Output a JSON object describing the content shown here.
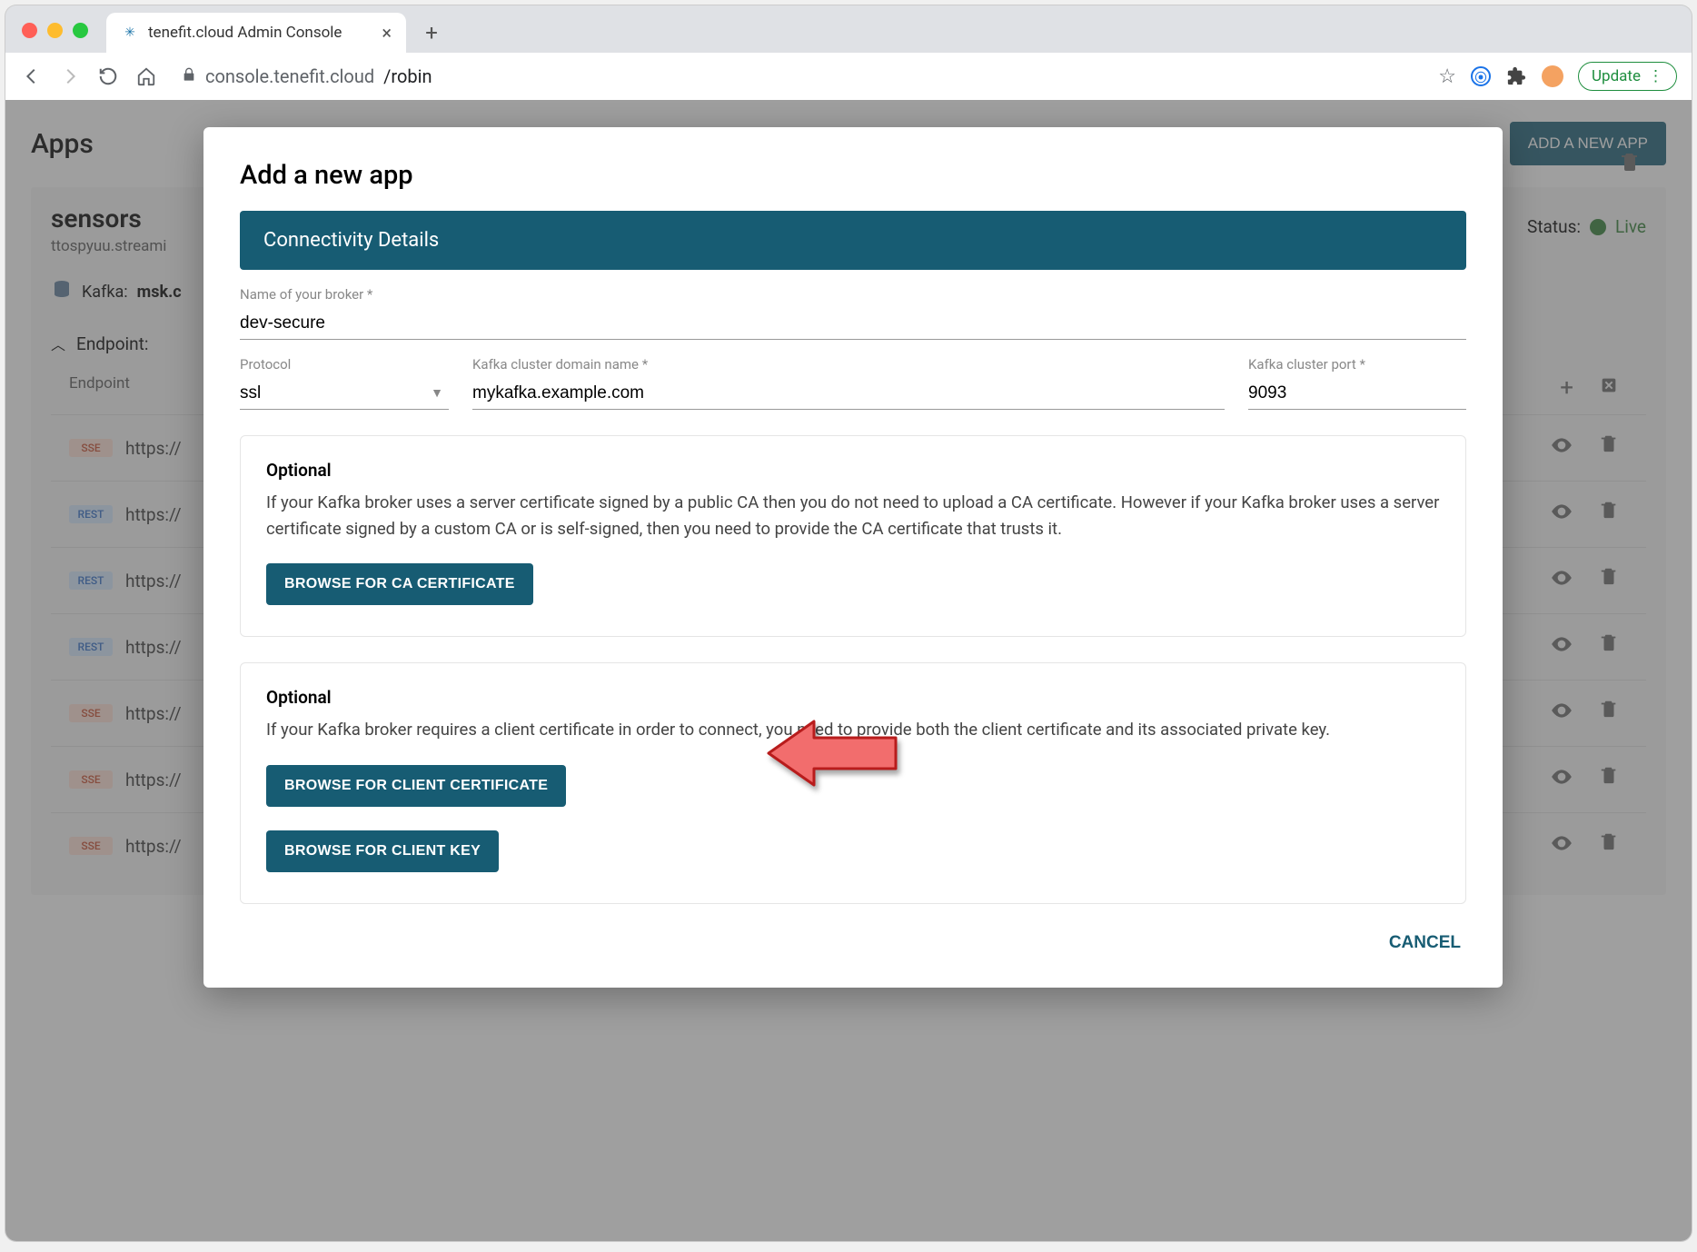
{
  "browser": {
    "tab_title": "tenefit.cloud Admin Console",
    "url_host": "console.tenefit.cloud",
    "url_path": "/robin",
    "update_label": "Update"
  },
  "page": {
    "apps_title": "Apps",
    "add_app_button": "ADD A NEW APP",
    "app_name": "sensors",
    "app_subdomain": "ttospyuu.streami",
    "kafka_label": "Kafka:",
    "kafka_value": "msk.c",
    "status_label": "Status:",
    "status_value": "Live",
    "endpoints_label": "Endpoint:",
    "table_header": "Endpoint",
    "endpoints": [
      {
        "type": "SSE",
        "url": "https://"
      },
      {
        "type": "REST",
        "url": "https://"
      },
      {
        "type": "REST",
        "url": "https://"
      },
      {
        "type": "REST",
        "url": "https://"
      },
      {
        "type": "SSE",
        "url": "https://"
      },
      {
        "type": "SSE",
        "url": "https://"
      },
      {
        "type": "SSE",
        "url": "https://"
      }
    ]
  },
  "modal": {
    "title": "Add a new app",
    "section_title": "Connectivity Details",
    "broker_name_label": "Name of your broker *",
    "broker_name_value": "dev-secure",
    "protocol_label": "Protocol",
    "protocol_value": "ssl",
    "domain_label": "Kafka cluster domain name *",
    "domain_value": "mykafka.example.com",
    "port_label": "Kafka cluster port *",
    "port_value": "9093",
    "optional_heading": "Optional",
    "ca_text": "If your Kafka broker uses a server certificate signed by a public CA then you do not need to upload a CA certificate. However if your Kafka broker uses a server certificate signed by a custom CA or is self-signed, then you need to provide the CA certificate that trusts it.",
    "browse_ca": "BROWSE FOR CA CERTIFICATE",
    "client_text": "If your Kafka broker requires a client certificate in order to connect, you need to provide both the client certificate and its associated private key.",
    "browse_client_cert": "BROWSE FOR CLIENT CERTIFICATE",
    "browse_client_key": "BROWSE FOR CLIENT KEY",
    "cancel": "CANCEL"
  }
}
